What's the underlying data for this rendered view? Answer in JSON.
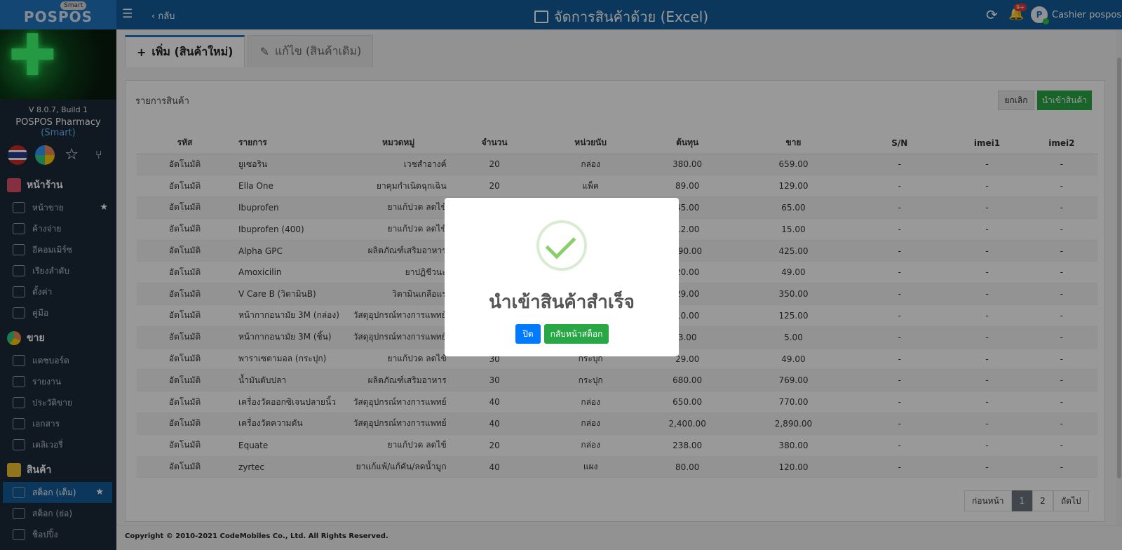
{
  "topbar": {
    "smart_badge": "Smart",
    "brand": "POSPOS",
    "back": "‹ กลับ",
    "title": "จัดการสินค้าด้วย (Excel)",
    "bell_badge": "9+",
    "avatar": "P",
    "user": "Cashier pospos"
  },
  "sidebar": {
    "version": "V 8.0.7, Build 1",
    "pharmacy": "POSPOS Pharmacy",
    "pharmacy_tag": "(Smart)",
    "sections": [
      {
        "label": "หน้าร้าน",
        "items": [
          "หน้าขาย",
          "ค้างจ่าย",
          "อีคอมเมิร์ซ",
          "เรียงลำดับ",
          "ตั้งค่า",
          "คู่มือ"
        ]
      },
      {
        "label": "ขาย",
        "items": [
          "แดชบอร์ด",
          "รายงาน",
          "ประวัติขาย",
          "เอกสาร",
          "เดลิเวอรี่"
        ]
      },
      {
        "label": "สินค้า",
        "items": [
          "สต็อก (เต็ม)",
          "สต็อก (ย่อ)",
          "ช็อปปิ้ง"
        ]
      }
    ]
  },
  "tabs": {
    "add": "เพิ่ม (สินค้าใหม่)",
    "edit": "แก้ไข (สินค้าเดิม)"
  },
  "panel": {
    "title": "รายการสินค้า",
    "cancel": "ยกเลิก",
    "import": "นำเข้าสินค้า"
  },
  "table": {
    "headers": [
      "รหัส",
      "รายการ",
      "หมวดหมู่",
      "จำนวน",
      "หน่วยนับ",
      "ต้นทุน",
      "ขาย",
      "S/N",
      "imei1",
      "imei2"
    ],
    "rows": [
      [
        "อัตโนมัติ",
        "ยูเซอริน",
        "เวชสำอางค์",
        "20",
        "กล่อง",
        "380.00",
        "659.00",
        "-",
        "-",
        "-"
      ],
      [
        "อัตโนมัติ",
        "Ella One",
        "ยาคุมกำเนิดฉุกเฉิน",
        "20",
        "แพ็ค",
        "89.00",
        "129.00",
        "-",
        "-",
        "-"
      ],
      [
        "อัตโนมัติ",
        "Ibuprofen",
        "ยาแก้ปวด ลดไข้",
        "",
        "",
        "45.00",
        "65.00",
        "-",
        "-",
        "-"
      ],
      [
        "อัตโนมัติ",
        "Ibuprofen (400)",
        "ยาแก้ปวด ลดไข้",
        "",
        "",
        "12.00",
        "15.00",
        "-",
        "-",
        "-"
      ],
      [
        "อัตโนมัติ",
        "Alpha GPC",
        "ผลิตภัณฑ์เสริมอาหาร",
        "",
        "",
        "390.00",
        "425.00",
        "-",
        "-",
        "-"
      ],
      [
        "อัตโนมัติ",
        "Amoxicilin",
        "ยาปฏิชีวนะ",
        "",
        "",
        "20.00",
        "49.00",
        "-",
        "-",
        "-"
      ],
      [
        "อัตโนมัติ",
        "V Care B (วิตามินB)",
        "วิตามินเกลือแร่",
        "",
        "",
        "29.00",
        "350.00",
        "-",
        "-",
        "-"
      ],
      [
        "อัตโนมัติ",
        "หน้ากากอนามัย 3M (กล่อง)",
        "วัสดุอุปกรณ์ทางการแพทย์",
        "",
        "",
        "10.00",
        "125.00",
        "-",
        "-",
        "-"
      ],
      [
        "อัตโนมัติ",
        "หน้ากากอนามัย 3M (ชิ้น)",
        "วัสดุอุปกรณ์ทางการแพทย์",
        "",
        "",
        "3.00",
        "5.00",
        "-",
        "-",
        "-"
      ],
      [
        "อัตโนมัติ",
        "พาราเซตามอล (กระปุก)",
        "ยาแก้ปวด ลดไข้",
        "30",
        "กระปุก",
        "29.00",
        "49.00",
        "-",
        "-",
        "-"
      ],
      [
        "อัตโนมัติ",
        "น้ำมันตับปลา",
        "ผลิตภัณฑ์เสริมอาหาร",
        "30",
        "กระปุก",
        "680.00",
        "769.00",
        "-",
        "-",
        "-"
      ],
      [
        "อัตโนมัติ",
        "เครื่องวัดออกซิเจนปลายนิ้ว",
        "วัสดุอุปกรณ์ทางการแพทย์",
        "40",
        "กล่อง",
        "650.00",
        "770.00",
        "-",
        "-",
        "-"
      ],
      [
        "อัตโนมัติ",
        "เครื่องวัดความดัน",
        "วัสดุอุปกรณ์ทางการแพทย์",
        "40",
        "กล่อง",
        "2,400.00",
        "2,890.00",
        "-",
        "-",
        "-"
      ],
      [
        "อัตโนมัติ",
        "Equate",
        "ยาแก้ปวด ลดไข้",
        "20",
        "กล่อง",
        "238.00",
        "380.00",
        "-",
        "-",
        "-"
      ],
      [
        "อัตโนมัติ",
        "zyrtec",
        "ยาแก้แพ้/แก้คัน/ลดน้ำมูก",
        "40",
        "แผง",
        "80.00",
        "120.00",
        "-",
        "-",
        "-"
      ]
    ]
  },
  "pager": {
    "prev": "ก่อนหน้า",
    "p1": "1",
    "p2": "2",
    "next": "ถัดไป"
  },
  "footer": "Copyright © 2010-2021 CodeMobiles Co., Ltd. All Rights Reserved.",
  "modal": {
    "title": "นำเข้าสินค้าสำเร็จ",
    "close": "ปิด",
    "back_stock": "กลับหน้าสต็อก"
  }
}
